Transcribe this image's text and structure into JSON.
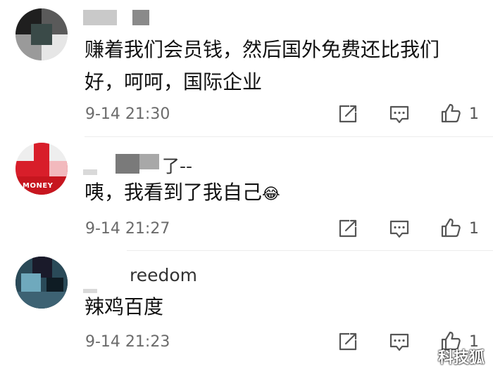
{
  "comments": [
    {
      "username": "",
      "text_line1": "赚着我们会员钱，然后国外免费还比我们",
      "text_line2": "好，呵呵，国际企业",
      "timestamp": "9-14 21:30",
      "likes": "1"
    },
    {
      "username": "了--",
      "text": "咦，我看到了我自己",
      "emoji": "😂",
      "timestamp": "9-14 21:27",
      "likes": "1",
      "avatar_text": "MONEY"
    },
    {
      "username": "reedom",
      "text": "辣鸡百度",
      "timestamp": "9-14 21:23",
      "likes": "1"
    }
  ],
  "watermark": "科技狐",
  "colors": {
    "meta": "#6b6b6b",
    "icon": "#555555",
    "avatar2_red": "#d81e2a"
  },
  "icons": {
    "forward": "share-square-icon",
    "reply": "comment-bubble-icon",
    "like": "thumbs-up-icon"
  }
}
